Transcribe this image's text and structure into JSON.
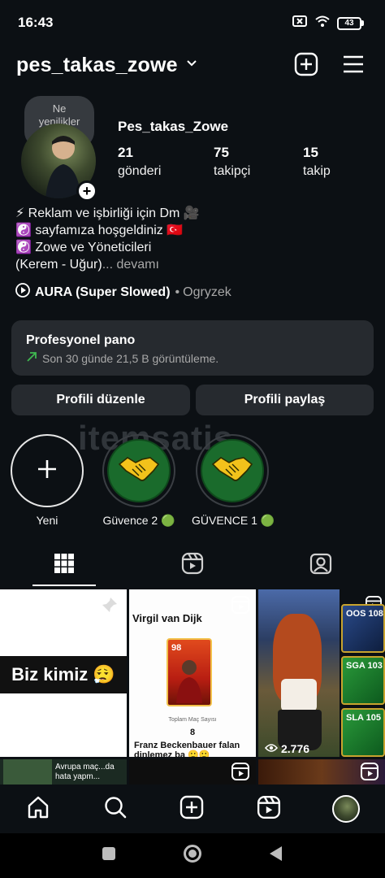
{
  "status_bar": {
    "time": "16:43",
    "battery": "43"
  },
  "header": {
    "username": "pes_takas_zowe"
  },
  "profile": {
    "note": "Ne yenilikler var?",
    "display_name": "Pes_takas_Zowe",
    "stats": [
      {
        "value": "21",
        "label": "gönderi"
      },
      {
        "value": "75",
        "label": "takipçi"
      },
      {
        "value": "15",
        "label": "takip"
      }
    ],
    "bio_lines": [
      "⚡ Reklam ve işbirliği için Dm 🎥",
      "☯️ sayfamıza hoşgeldiniz 🇹🇷",
      "☯️ Zowe ve Yöneticileri",
      "(Kerem - Uğur)"
    ],
    "bio_more": "... devamı",
    "music": {
      "title": "AURA (Super Slowed)",
      "separator": "•",
      "artist": "Ogryzek"
    }
  },
  "pro_panel": {
    "title": "Profesyonel pano",
    "subtitle": "Son 30 günde 21,5 B görüntüleme."
  },
  "actions": {
    "edit": "Profili düzenle",
    "share": "Profili paylaş"
  },
  "highlights": [
    {
      "label": "Yeni",
      "icon": "plus-icon"
    },
    {
      "label": "Güvence 2 🟢",
      "icon": "handshake-icon"
    },
    {
      "label": "GÜVENCE 1 🟢",
      "icon": "handshake-icon"
    }
  ],
  "watermark": "itemsatis",
  "tabs": [
    {
      "name": "grid",
      "icon": "grid-icon",
      "active": true
    },
    {
      "name": "reels",
      "icon": "reels-icon",
      "active": false
    },
    {
      "name": "tagged",
      "icon": "tagged-icon",
      "active": false
    }
  ],
  "posts": {
    "post1_text": "Biz kimiz 😮‍💨",
    "post2_title": "Virgil van Dijk",
    "post2_card_rating": "98",
    "post2_stat_label": "Toplam Maç Sayısı",
    "post2_stat_value": "8",
    "post2_caption": "Franz Beckenbauer falan dinlemez ba 🙂🙂",
    "post3_views": "2.776",
    "post4_cards": [
      {
        "label": "OOS 108"
      },
      {
        "label": "SGA 103"
      },
      {
        "label": "SLA 105"
      }
    ],
    "post5_text": "Avrupa maç...da hata yapm..."
  },
  "colors": {
    "background": "#0c1014",
    "panel": "#262a2f",
    "accent_green": "#1a6b2c",
    "trend_green": "#3fb950"
  }
}
